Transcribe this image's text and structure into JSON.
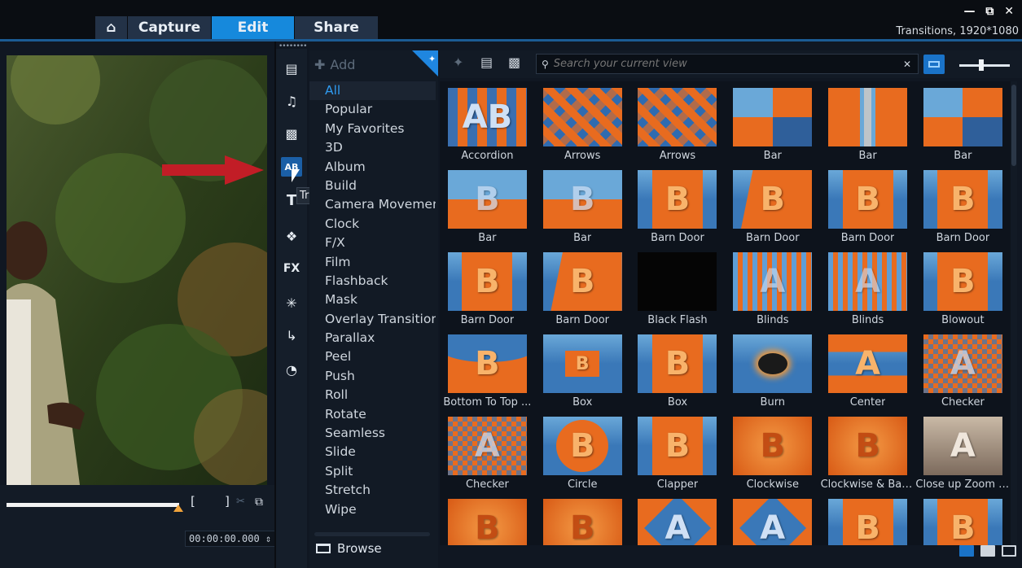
{
  "app": {
    "tabs": [
      {
        "id": "home",
        "label": ""
      },
      {
        "id": "capture",
        "label": "Capture"
      },
      {
        "id": "edit",
        "label": "Edit"
      },
      {
        "id": "share",
        "label": "Share"
      }
    ],
    "active_tab": "Edit",
    "project_info": "Transitions, 1920*1080"
  },
  "library": {
    "tools": [
      "media-icon",
      "audio-icon",
      "instant-project-icon",
      "transitions-icon",
      "title-icon",
      "graphics-icon",
      "fx-icon",
      "particle-icon",
      "path-icon",
      "speed-icon"
    ],
    "active_tool": "transitions-icon",
    "tooltip": "Transitions",
    "add_label": "Add",
    "browse_label": "Browse"
  },
  "categories": [
    "All",
    "Popular",
    "My Favorites",
    "3D",
    "Album",
    "Build",
    "Camera Movement",
    "Clock",
    "F/X",
    "Film",
    "Flashback",
    "Mask",
    "Overlay Transitions",
    "Parallax",
    "Peel",
    "Push",
    "Roll",
    "Rotate",
    "Seamless",
    "Slide",
    "Split",
    "Stretch",
    "Wipe"
  ],
  "selected_category": "All",
  "search": {
    "placeholder": "Search your current view"
  },
  "player": {
    "timecode": "00:00:00.000",
    "mark_in": "[",
    "mark_out": "]"
  },
  "transitions": [
    {
      "label": "Accordion",
      "style": "stripes"
    },
    {
      "label": "Arrows",
      "style": "arrows"
    },
    {
      "label": "Arrows",
      "style": "arrows"
    },
    {
      "label": "Bar",
      "style": "split"
    },
    {
      "label": "Bar",
      "style": "bar"
    },
    {
      "label": "Bar",
      "style": "split"
    },
    {
      "label": "Bar",
      "style": "half"
    },
    {
      "label": "Bar",
      "style": "half"
    },
    {
      "label": "Barn Door",
      "style": "b"
    },
    {
      "label": "Barn Door",
      "style": "fold"
    },
    {
      "label": "Barn Door",
      "style": "b"
    },
    {
      "label": "Barn Door",
      "style": "b"
    },
    {
      "label": "Barn Door",
      "style": "b"
    },
    {
      "label": "Barn Door",
      "style": "fold"
    },
    {
      "label": "Black Flash",
      "style": "black"
    },
    {
      "label": "Blinds",
      "style": "blinds"
    },
    {
      "label": "Blinds",
      "style": "blinds"
    },
    {
      "label": "Blowout",
      "style": "b"
    },
    {
      "label": "Bottom To Top ...",
      "style": "wave"
    },
    {
      "label": "Box",
      "style": "box"
    },
    {
      "label": "Box",
      "style": "b"
    },
    {
      "label": "Burn",
      "style": "burn"
    },
    {
      "label": "Center",
      "style": "center"
    },
    {
      "label": "Checker",
      "style": "checker"
    },
    {
      "label": "Checker",
      "style": "checker"
    },
    {
      "label": "Circle",
      "style": "circle"
    },
    {
      "label": "Clapper",
      "style": "b"
    },
    {
      "label": "Clockwise",
      "style": "orange"
    },
    {
      "label": "Clockwise & Bala...",
      "style": "orange"
    },
    {
      "label": "Close up Zoom I...",
      "style": "zoom"
    },
    {
      "label": "",
      "style": "orange"
    },
    {
      "label": "",
      "style": "orange"
    },
    {
      "label": "",
      "style": "diamond"
    },
    {
      "label": "",
      "style": "diamond"
    },
    {
      "label": "",
      "style": "b"
    },
    {
      "label": "",
      "style": "b"
    }
  ]
}
